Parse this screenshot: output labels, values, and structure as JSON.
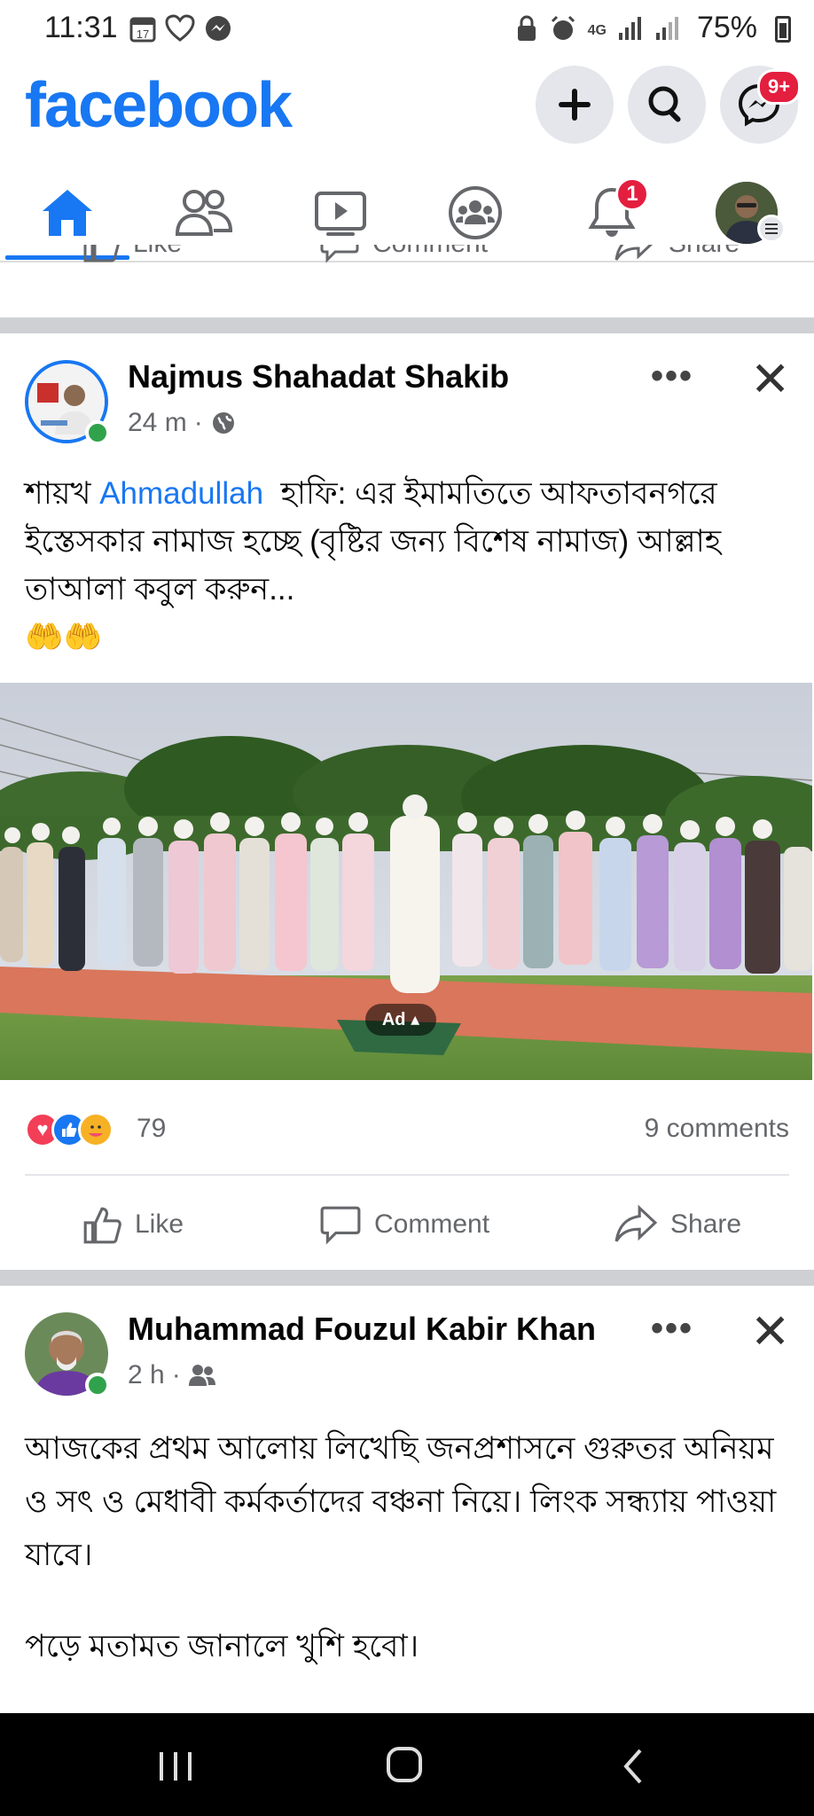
{
  "status_bar": {
    "time": "11:31",
    "calendar_day": "17",
    "battery": "75%",
    "network": "4G"
  },
  "header": {
    "logo": "facebook",
    "messenger_badge": "9+",
    "colors": {
      "brand": "#1877F2",
      "badge": "#e41e3f"
    }
  },
  "nav": {
    "tabs": [
      "home",
      "friends",
      "watch",
      "groups",
      "notifications",
      "profile"
    ],
    "notification_badge": "1"
  },
  "actions": {
    "like": "Like",
    "comment": "Comment",
    "share": "Share"
  },
  "posts": [
    {
      "author": "Najmus Shahadat Shakib",
      "time": "24 m",
      "audience_icon": "globe-icon",
      "text_before_mention": "শায়খ ",
      "mention": "Ahmadullah",
      "text_after_mention": "  হাফি: এর ইমামতিতে আফতাবনগরে ইস্তেসকার নামাজ হচ্ছে (বৃষ্টির জন্য বিশেষ নামাজ) আল্লাহ তাআলা কবুল করুন...",
      "emoji": "🤲🤲",
      "photo_badge": "Ad",
      "reaction_count": "79",
      "comments": "9 comments"
    },
    {
      "author": "Muhammad Fouzul Kabir Khan",
      "time": "2 h",
      "audience_icon": "friends-icon",
      "text": "আজকের প্রথম আলোয় লিখেছি জনপ্রশাসনে গুরুতর অনিয়ম ও সৎ ও মেধাবী কর্মকর্তাদের বঞ্চনা নিয়ে। লিংক সন্ধ্যায় পাওয়া যাবে।",
      "text2": "পড়ে মতামত জানালে খুশি হবো।"
    }
  ]
}
